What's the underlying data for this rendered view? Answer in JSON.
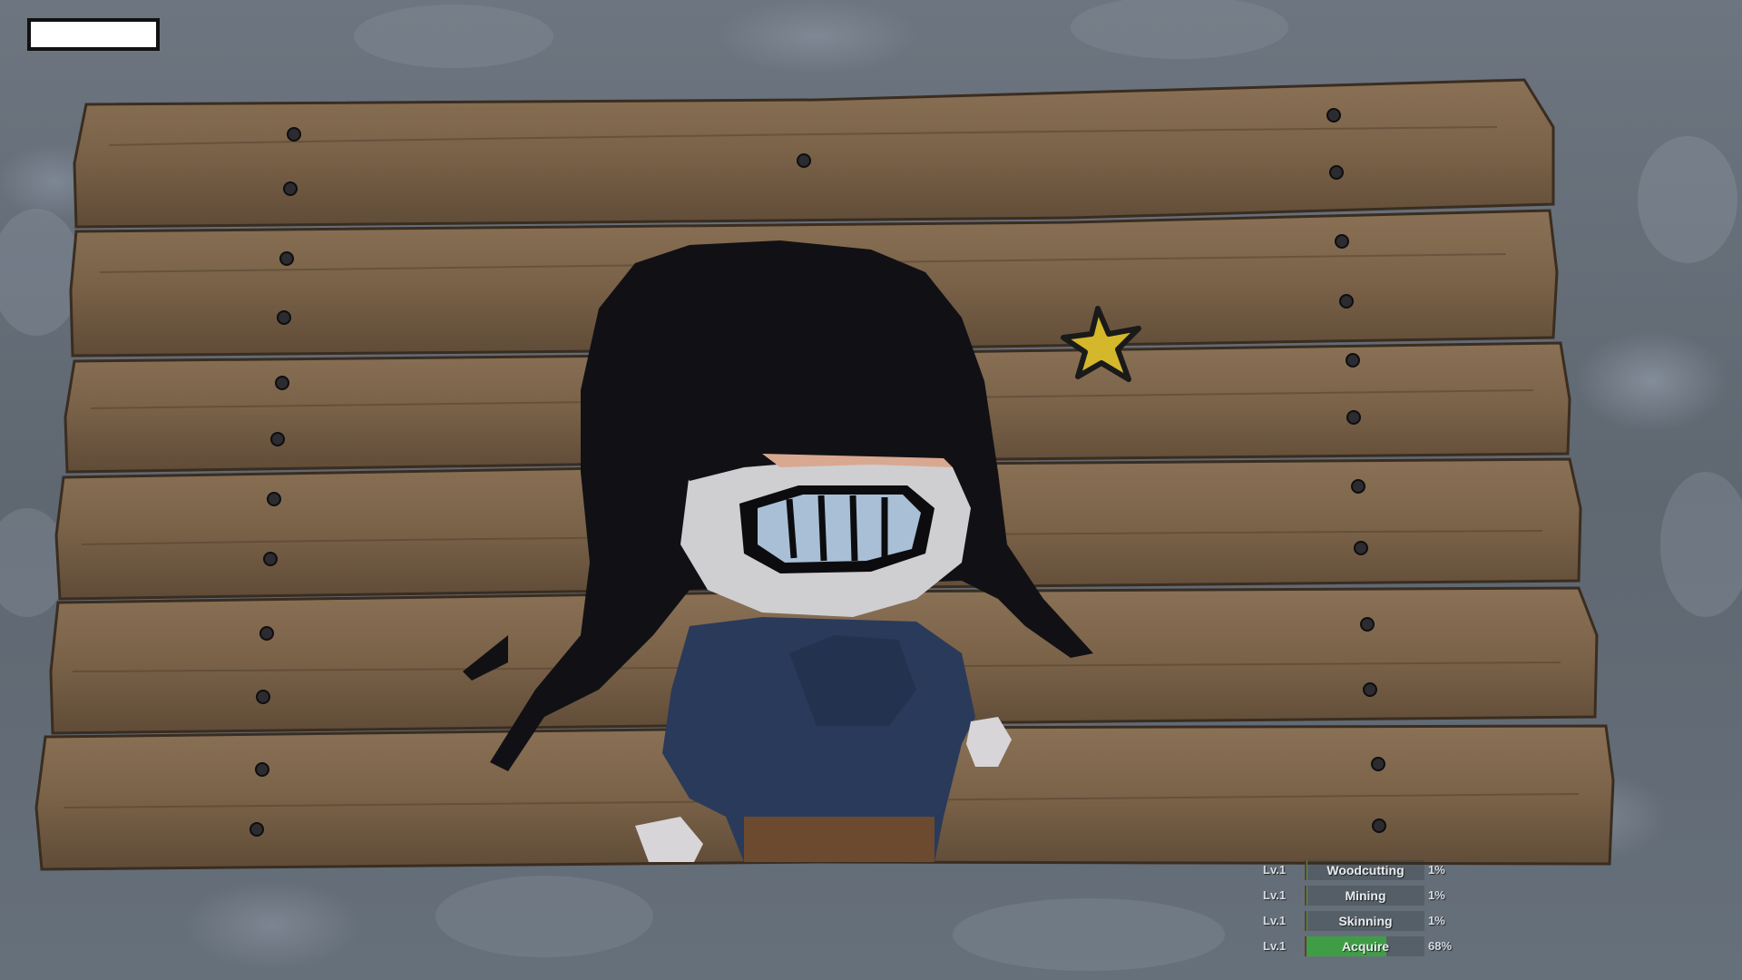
{
  "hud": {
    "skills": [
      {
        "level": "Lv.1",
        "name": "Woodcutting",
        "percent": "1%",
        "progress": 0.01
      },
      {
        "level": "Lv.1",
        "name": "Mining",
        "percent": "1%",
        "progress": 0.01
      },
      {
        "level": "Lv.1",
        "name": "Skinning",
        "percent": "1%",
        "progress": 0.01
      },
      {
        "level": "Lv.1",
        "name": "Acquire",
        "percent": "68%",
        "progress": 0.68
      }
    ]
  },
  "colors": {
    "progress_fill": "#3f9e45",
    "wood": "#7a6248",
    "hair": "#111115",
    "shirt": "#2a3a5a",
    "star": "#d4b72a"
  }
}
